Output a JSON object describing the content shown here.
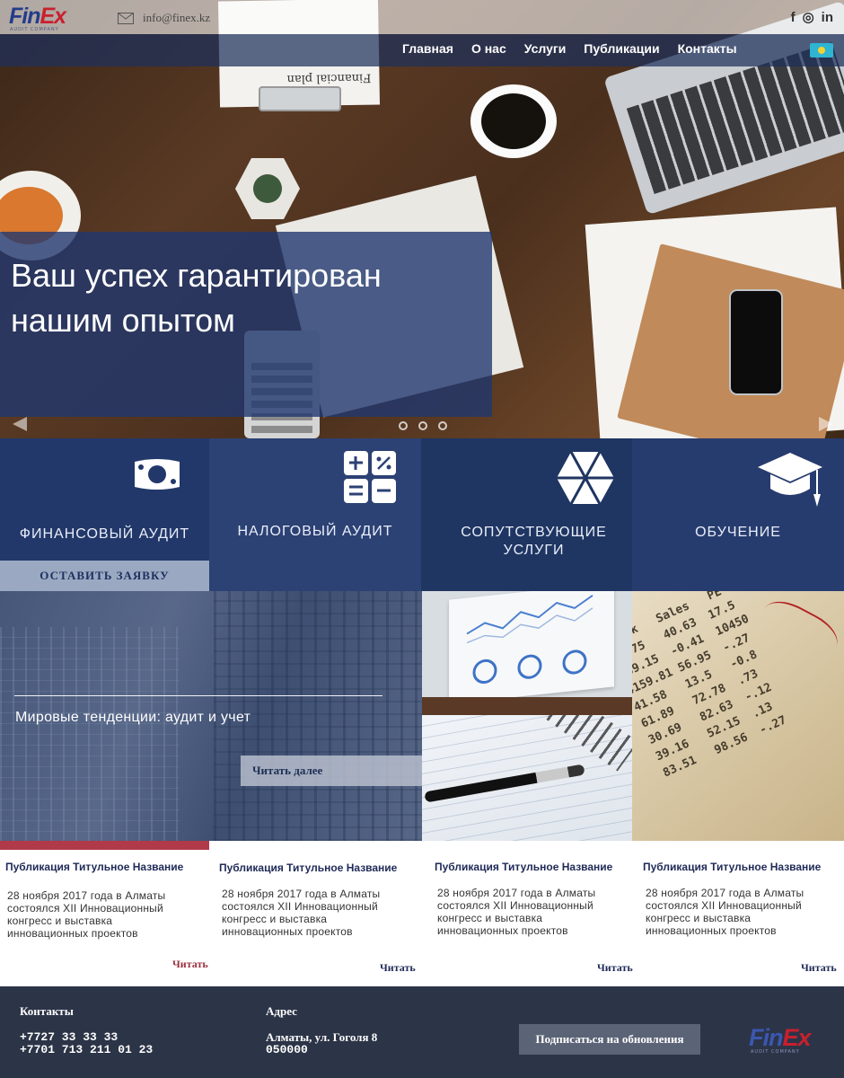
{
  "header": {
    "logo": {
      "main": "Fin",
      "accent": "Ex",
      "sub": "AUDIT COMPANY"
    },
    "email": "info@finex.kz",
    "social": [
      {
        "name": "facebook",
        "glyph": "f"
      },
      {
        "name": "instagram",
        "glyph": "◎"
      },
      {
        "name": "linkedin",
        "glyph": "in"
      }
    ],
    "nav": [
      "Главная",
      "О нас",
      "Услуги",
      "Публикации",
      "Контакты"
    ],
    "language_flag": "kz"
  },
  "hero": {
    "headline": "Ваш успех гарантирован нашим опытом",
    "paper_text": "Financial plan",
    "slides": 3
  },
  "services": [
    {
      "label": "ФИНАНСОВЫЙ АУДИТ",
      "icon": "banknote-icon"
    },
    {
      "label": "НАЛОГОВЫЙ АУДИТ",
      "icon": "calculator-icon"
    },
    {
      "label": "СОПУТСТВУЮЩИЕ УСЛУГИ",
      "icon": "hexagon-icon"
    },
    {
      "label": "ОБУЧЕНИЕ",
      "icon": "graduation-cap-icon"
    }
  ],
  "order_button": "ОСТАВИТЬ ЗАЯВКУ",
  "feature": {
    "title": "Мировые тенденции: аудит и учет",
    "more": "Читать далее"
  },
  "publications": [
    {
      "title": "Публикация Титульное Название",
      "body": "28 ноября 2017 года в Алматы состоялся XII Инновационный конгресс и выставка инновационных проектов",
      "read": "Читать"
    },
    {
      "title": "Публикация Титульное Название",
      "body": "28 ноября 2017 года в Алматы состоялся XII Инновационный конгресс и выставка инновационных проектов",
      "read": "Читать"
    },
    {
      "title": "Публикация Титульное Название",
      "body": "28 ноября 2017 года в Алматы состоялся XII Инновационный конгресс и выставка инновационных проектов",
      "read": "Читать"
    },
    {
      "title": "Публикация Титульное Название",
      "body": "28 ноября 2017 года в Алматы состоялся XII Инновационный конгресс и выставка инновационных проектов",
      "read": "Читать"
    }
  ],
  "footer": {
    "contacts_title": "Контакты",
    "phone1": "+7727 33 33 33",
    "phone2": "+7701 713 211 01 23",
    "address_title": "Адрес",
    "address1": "Алматы, ул. Гоголя 8",
    "address2": "050000",
    "subscribe": "Подписаться на обновления"
  },
  "colors": {
    "brand_blue": "#233c8a",
    "brand_red": "#c8202e",
    "navy": "#22386a",
    "footer": "#2c3447",
    "accent_red": "#b03a4a"
  }
}
